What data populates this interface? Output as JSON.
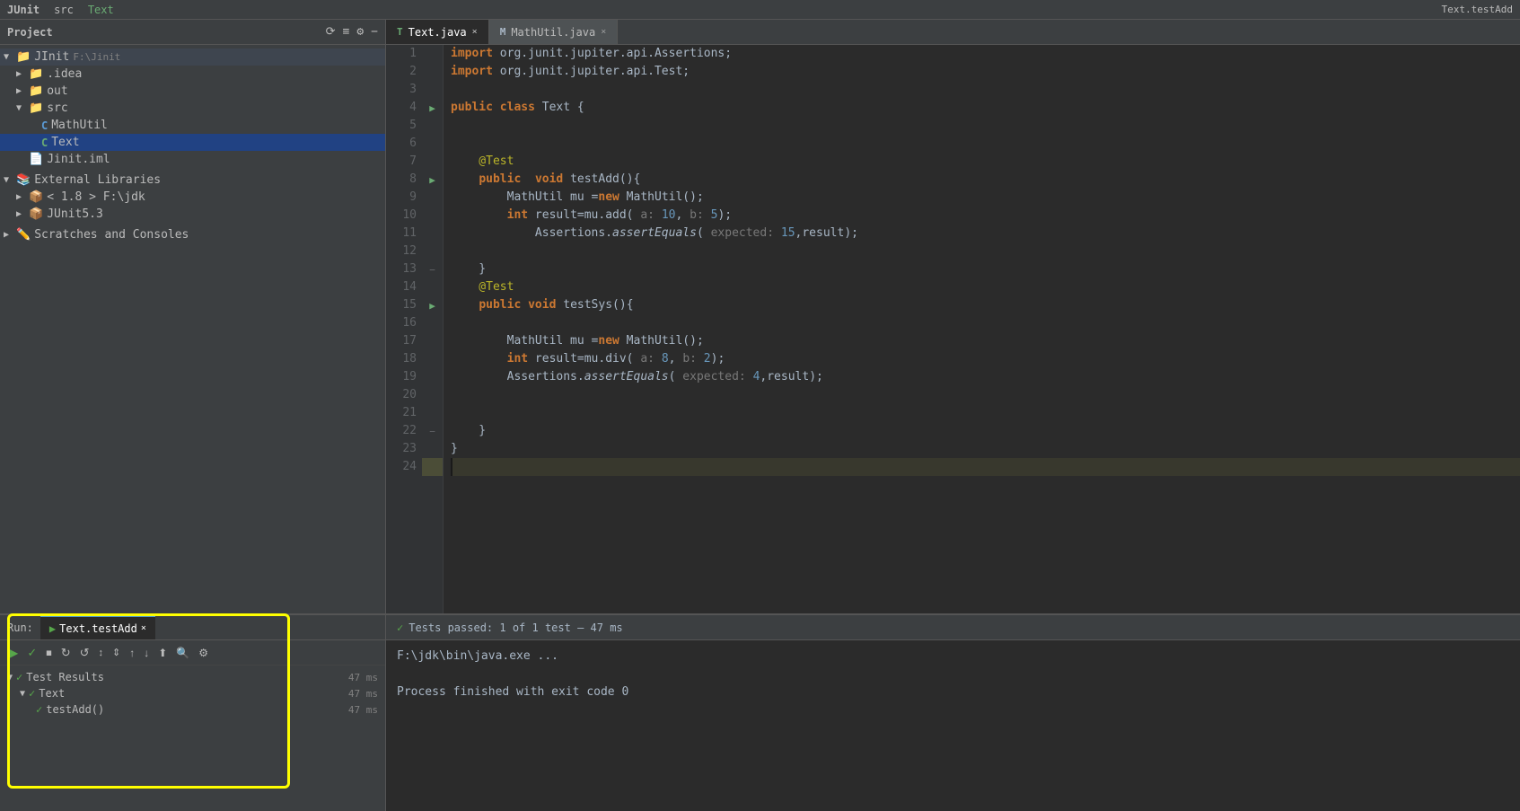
{
  "app": {
    "title": "JUnit",
    "breadcrumb": [
      "JUnit",
      "src",
      "Text"
    ]
  },
  "tabs": [
    {
      "label": "Text.java",
      "type": "text",
      "active": true
    },
    {
      "label": "MathUtil.java",
      "type": "mathutil",
      "active": false
    }
  ],
  "sidebar": {
    "title": "Project",
    "root": "JInit",
    "root_path": "F:\\Jinit",
    "items": [
      {
        "indent": 0,
        "type": "root",
        "label": "JInit",
        "path": "F:\\Jinit",
        "expanded": true
      },
      {
        "indent": 1,
        "type": "folder",
        "label": ".idea",
        "expanded": false
      },
      {
        "indent": 1,
        "type": "folder",
        "label": "out",
        "expanded": false
      },
      {
        "indent": 1,
        "type": "folder",
        "label": "src",
        "expanded": true
      },
      {
        "indent": 2,
        "type": "java-blue",
        "label": "MathUtil",
        "expanded": false
      },
      {
        "indent": 2,
        "type": "java-green",
        "label": "Text",
        "expanded": false,
        "selected": true
      },
      {
        "indent": 1,
        "type": "iml",
        "label": "Jinit.iml",
        "expanded": false
      },
      {
        "indent": 0,
        "type": "ext-libs",
        "label": "External Libraries",
        "expanded": true
      },
      {
        "indent": 1,
        "type": "lib",
        "label": "< 1.8 > F:\\jdk",
        "expanded": false
      },
      {
        "indent": 1,
        "type": "lib",
        "label": "JUnit5.3",
        "expanded": false
      },
      {
        "indent": 0,
        "type": "scratches",
        "label": "Scratches and Consoles",
        "expanded": false
      }
    ]
  },
  "code": {
    "filename": "Text.java",
    "lines": [
      {
        "n": 1,
        "text": "import org.junit.jupiter.api.Assertions;",
        "gutter": ""
      },
      {
        "n": 2,
        "text": "import org.junit.jupiter.api.Test;",
        "gutter": ""
      },
      {
        "n": 3,
        "text": "",
        "gutter": ""
      },
      {
        "n": 4,
        "text": "public class Text {",
        "gutter": "run"
      },
      {
        "n": 5,
        "text": "",
        "gutter": ""
      },
      {
        "n": 6,
        "text": "",
        "gutter": ""
      },
      {
        "n": 7,
        "text": "    @Test",
        "gutter": ""
      },
      {
        "n": 8,
        "text": "    public  void testAdd(){",
        "gutter": "run"
      },
      {
        "n": 9,
        "text": "        MathUtil mu =new MathUtil();",
        "gutter": ""
      },
      {
        "n": 10,
        "text": "        int result=mu.add( a: 10, b: 5);",
        "gutter": ""
      },
      {
        "n": 11,
        "text": "            Assertions.assertEquals( expected: 15,result);",
        "gutter": ""
      },
      {
        "n": 12,
        "text": "",
        "gutter": ""
      },
      {
        "n": 13,
        "text": "    }",
        "gutter": "fold"
      },
      {
        "n": 14,
        "text": "    @Test",
        "gutter": ""
      },
      {
        "n": 15,
        "text": "    public void testSys(){",
        "gutter": "run"
      },
      {
        "n": 16,
        "text": "",
        "gutter": ""
      },
      {
        "n": 17,
        "text": "        MathUtil mu =new MathUtil();",
        "gutter": ""
      },
      {
        "n": 18,
        "text": "        int result=mu.div( a: 8, b: 2);",
        "gutter": ""
      },
      {
        "n": 19,
        "text": "        Assertions.assertEquals( expected: 4,result);",
        "gutter": ""
      },
      {
        "n": 20,
        "text": "",
        "gutter": ""
      },
      {
        "n": 21,
        "text": "",
        "gutter": ""
      },
      {
        "n": 22,
        "text": "    }",
        "gutter": "fold"
      },
      {
        "n": 23,
        "text": "}",
        "gutter": ""
      },
      {
        "n": 24,
        "text": "",
        "gutter": ""
      }
    ]
  },
  "run_panel": {
    "tab_label": "Text.testAdd",
    "status": "Tests passed: 1 of 1 test – 47 ms",
    "tree": [
      {
        "label": "Test Results",
        "time": "47 ms",
        "status": "pass",
        "indent": 0
      },
      {
        "label": "Text",
        "time": "47 ms",
        "status": "pass",
        "indent": 1
      },
      {
        "label": "testAdd()",
        "time": "47 ms",
        "status": "pass",
        "indent": 2
      }
    ],
    "output_lines": [
      "F:\\jdk\\bin\\java.exe ...",
      "",
      "Process finished with exit code 0"
    ]
  }
}
